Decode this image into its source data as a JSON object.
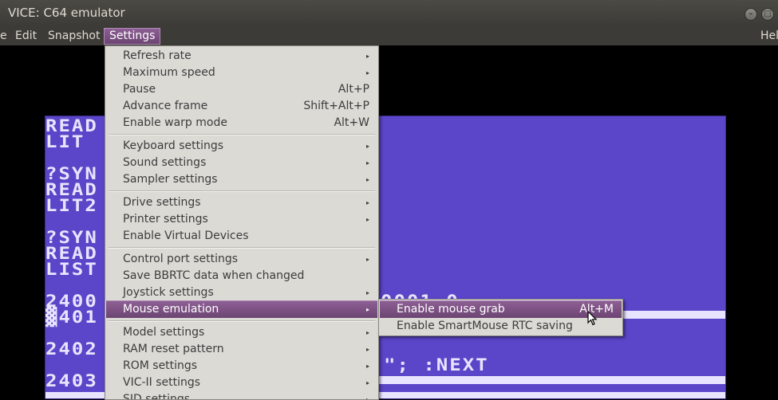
{
  "window": {
    "title": "VICE: C64 emulator"
  },
  "menubar": {
    "items": [
      "e",
      "Edit",
      "Snapshot",
      "Settings"
    ],
    "help": "Hel"
  },
  "c64_screen": {
    "lines": [
      "READ",
      "LIT",
      "?SYN",
      "READ",
      "LIT2",
      "?SYN",
      "READ",
      "LIST",
      "2400",
      "▓401",
      "2402",
      "2403"
    ],
    "fragment_1": "0001 0",
    "fragment_2": "\"; :NEXT"
  },
  "settings_menu": {
    "items": [
      {
        "label": "Refresh rate",
        "accel": "",
        "submenu": true
      },
      {
        "label": "Maximum speed",
        "accel": "",
        "submenu": true
      },
      {
        "label": "Pause",
        "accel": "Alt+P",
        "submenu": false
      },
      {
        "label": "Advance frame",
        "accel": "Shift+Alt+P",
        "submenu": false
      },
      {
        "label": "Enable warp mode",
        "accel": "Alt+W",
        "submenu": false
      },
      {
        "label": "Keyboard settings",
        "accel": "",
        "submenu": true
      },
      {
        "label": "Sound settings",
        "accel": "",
        "submenu": true
      },
      {
        "label": "Sampler settings",
        "accel": "",
        "submenu": true
      },
      {
        "label": "Drive settings",
        "accel": "",
        "submenu": true
      },
      {
        "label": "Printer settings",
        "accel": "",
        "submenu": true
      },
      {
        "label": "Enable Virtual Devices",
        "accel": "",
        "submenu": false
      },
      {
        "label": "Control port settings",
        "accel": "",
        "submenu": true
      },
      {
        "label": "Save BBRTC data when changed",
        "accel": "",
        "submenu": false
      },
      {
        "label": "Joystick settings",
        "accel": "",
        "submenu": true
      },
      {
        "label": "Mouse emulation",
        "accel": "",
        "submenu": true,
        "highlighted": true
      },
      {
        "label": "Model settings",
        "accel": "",
        "submenu": true
      },
      {
        "label": "RAM reset pattern",
        "accel": "",
        "submenu": true
      },
      {
        "label": "ROM settings",
        "accel": "",
        "submenu": true
      },
      {
        "label": "VIC-II settings",
        "accel": "",
        "submenu": true
      },
      {
        "label": "SID settings",
        "accel": "",
        "submenu": true
      }
    ],
    "arrow_glyph": "▸"
  },
  "mouse_submenu": {
    "items": [
      {
        "label": "Enable mouse grab",
        "accel": "Alt+M",
        "highlighted": true
      },
      {
        "label": "Enable SmartMouse RTC saving",
        "accel": ""
      }
    ]
  },
  "colors": {
    "accent": "#7a4f80",
    "menu_bg": "#dcdad5",
    "c64_blue": "#5b45c8",
    "titlebar": "#3c3b37"
  }
}
